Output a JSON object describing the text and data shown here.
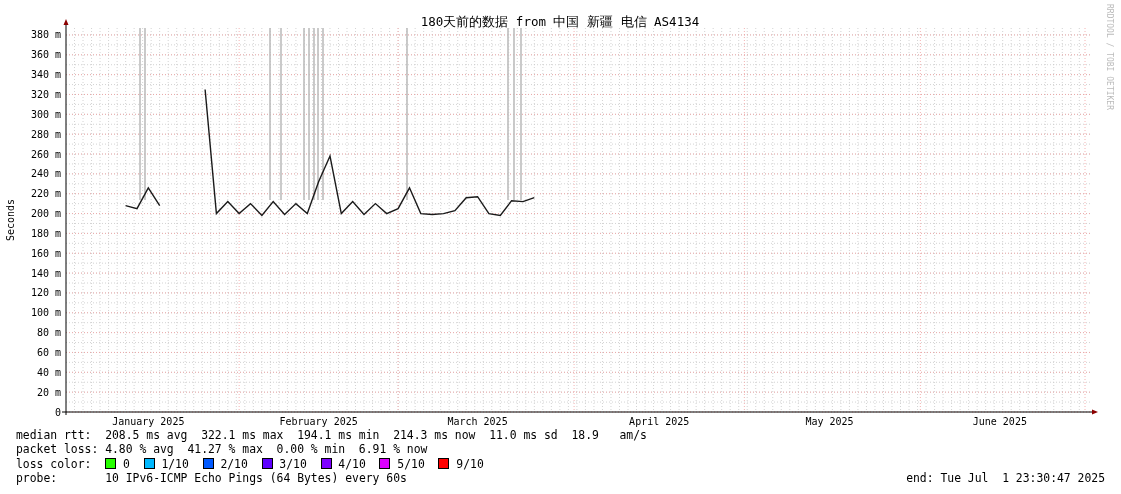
{
  "graph": {
    "credit": "RRDTOOL / TOBI OETIKER",
    "chart_data": {
      "type": "line",
      "title": "180天前的数据 from 中国 新疆 电信 AS4134",
      "ylabel": "Seconds",
      "categories": [
        null,
        null,
        null,
        null,
        null,
        null,
        null,
        "January 2025",
        null,
        null,
        null,
        null,
        null,
        null,
        null,
        null,
        null,
        null,
        null,
        null,
        null,
        null,
        "February 2025",
        null,
        null,
        null,
        null,
        null,
        null,
        null,
        null,
        null,
        null,
        null,
        null,
        null,
        "March 2025",
        null,
        null,
        null,
        null,
        null,
        null,
        null,
        null,
        null,
        null,
        null,
        null,
        null,
        null,
        null,
        "April 2025",
        null,
        null,
        null,
        null,
        null,
        null,
        null,
        null,
        null,
        null,
        null,
        null,
        null,
        null,
        "May 2025",
        null,
        null,
        null,
        null,
        null,
        null,
        null,
        null,
        null,
        null,
        null,
        null,
        null,
        null,
        "June 2025",
        null,
        null,
        null,
        null,
        null,
        null,
        null
      ],
      "series": [
        {
          "color": "#1a1a1a",
          "values": [
            null,
            null,
            null,
            null,
            null,
            208,
            205,
            226,
            208,
            null,
            null,
            null,
            325,
            200,
            212,
            200,
            210,
            198,
            212,
            199,
            210,
            200,
            232,
            258,
            200,
            212,
            199,
            210,
            200,
            205,
            226,
            200,
            199,
            200,
            203,
            216,
            217,
            200,
            198,
            213,
            212,
            216,
            null,
            null,
            null,
            null,
            null,
            null,
            null,
            null,
            null,
            null,
            null,
            null,
            null,
            null,
            null,
            null,
            null,
            null,
            null,
            null,
            null,
            null,
            null,
            null,
            null,
            null,
            null,
            null,
            null,
            null,
            null,
            null,
            null,
            null,
            null,
            null,
            null,
            null,
            null,
            null,
            null,
            null,
            null,
            null,
            null,
            null,
            null,
            null
          ]
        }
      ],
      "grid": true,
      "ylim": [
        0,
        387
      ],
      "yticks": [
        {
          "value": 0,
          "label": "0"
        },
        {
          "value": 20,
          "label": "20 m"
        },
        {
          "value": 40,
          "label": "40 m"
        },
        {
          "value": 60,
          "label": "60 m"
        },
        {
          "value": 80,
          "label": "80 m"
        },
        {
          "value": 100,
          "label": "100 m"
        },
        {
          "value": 120,
          "label": "120 m"
        },
        {
          "value": 140,
          "label": "140 m"
        },
        {
          "value": 160,
          "label": "160 m"
        },
        {
          "value": 180,
          "label": "180 m"
        },
        {
          "value": 200,
          "label": "200 m"
        },
        {
          "value": 220,
          "label": "220 m"
        },
        {
          "value": 240,
          "label": "240 m"
        },
        {
          "value": 260,
          "label": "260 m"
        },
        {
          "value": 280,
          "label": "280 m"
        },
        {
          "value": 300,
          "label": "300 m"
        },
        {
          "value": 320,
          "label": "320 m"
        },
        {
          "value": 340,
          "label": "340 m"
        },
        {
          "value": 360,
          "label": "360 m"
        },
        {
          "value": 380,
          "label": "380 m"
        }
      ]
    }
  },
  "legend": {
    "median_rtt": {
      "label": "median rtt:",
      "items": [
        "208.5 ms avg",
        "322.1 ms max",
        "194.1 ms min",
        "214.3 ms now",
        "11.0 ms sd",
        "18.9 ",
        "am/s"
      ]
    },
    "packet_loss": {
      "label": "packet loss:",
      "items": [
        "4.80 % avg",
        "41.27 % max",
        "0.00 % min",
        "6.91 % now"
      ]
    },
    "loss_color": {
      "label": "loss color:",
      "items": [
        {
          "label": "0",
          "color": "#26ff00"
        },
        {
          "label": "1/10",
          "color": "#00b8ff"
        },
        {
          "label": "2/10",
          "color": "#0059ff"
        },
        {
          "label": "3/10",
          "color": "#5e00ff"
        },
        {
          "label": "4/10",
          "color": "#7e00ff"
        },
        {
          "label": "5/10",
          "color": "#dd00ff"
        },
        {
          "label": "9/10",
          "color": "#ff0000"
        }
      ]
    },
    "probe": {
      "label": "probe:",
      "text": "10 IPv6-ICMP Echo Pings (64 Bytes) every 60s"
    },
    "end": "end: Tue Jul  1 23:30:47 2025"
  }
}
